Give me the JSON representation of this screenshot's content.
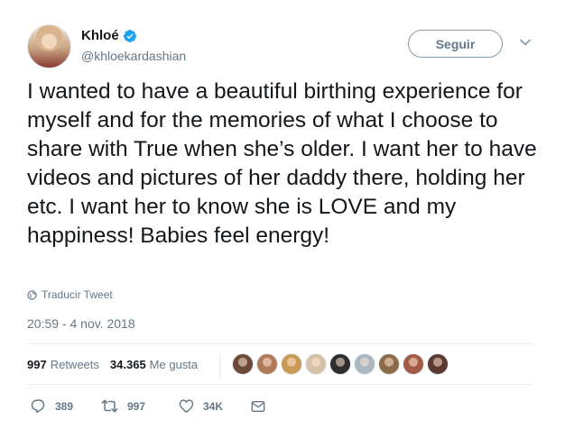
{
  "user": {
    "name": "Khloé",
    "handle": "@khloekardashian",
    "verified": true
  },
  "header": {
    "follow_label": "Seguir"
  },
  "tweet": {
    "text": "I wanted to have a beautiful birthing experience for myself and for the memories of what I choose to share with True when she’s older. I want her to have videos and pictures of her daddy there, holding her etc. I want her to know she is LOVE and my happiness! Babies feel energy!",
    "translate_label": "Traducir Tweet",
    "timestamp": "20:59 - 4 nov. 2018"
  },
  "stats": {
    "retweets_count": "997",
    "retweets_label": "Retweets",
    "likes_count": "34.365",
    "likes_label": "Me gusta"
  },
  "likers": [
    {
      "color": "#6b4a3a"
    },
    {
      "color": "#b07a5a"
    },
    {
      "color": "#c99a55"
    },
    {
      "color": "#d6c2a8"
    },
    {
      "color": "#2e2e2e"
    },
    {
      "color": "#aab8c2"
    },
    {
      "color": "#8c6b4a"
    },
    {
      "color": "#a35b45"
    },
    {
      "color": "#5a3a30"
    }
  ],
  "actions": {
    "replies": "389",
    "retweets": "997",
    "likes": "34K"
  },
  "colors": {
    "verified": "#1da1f2",
    "secondary_text": "#657786",
    "primary_text": "#14171a"
  }
}
